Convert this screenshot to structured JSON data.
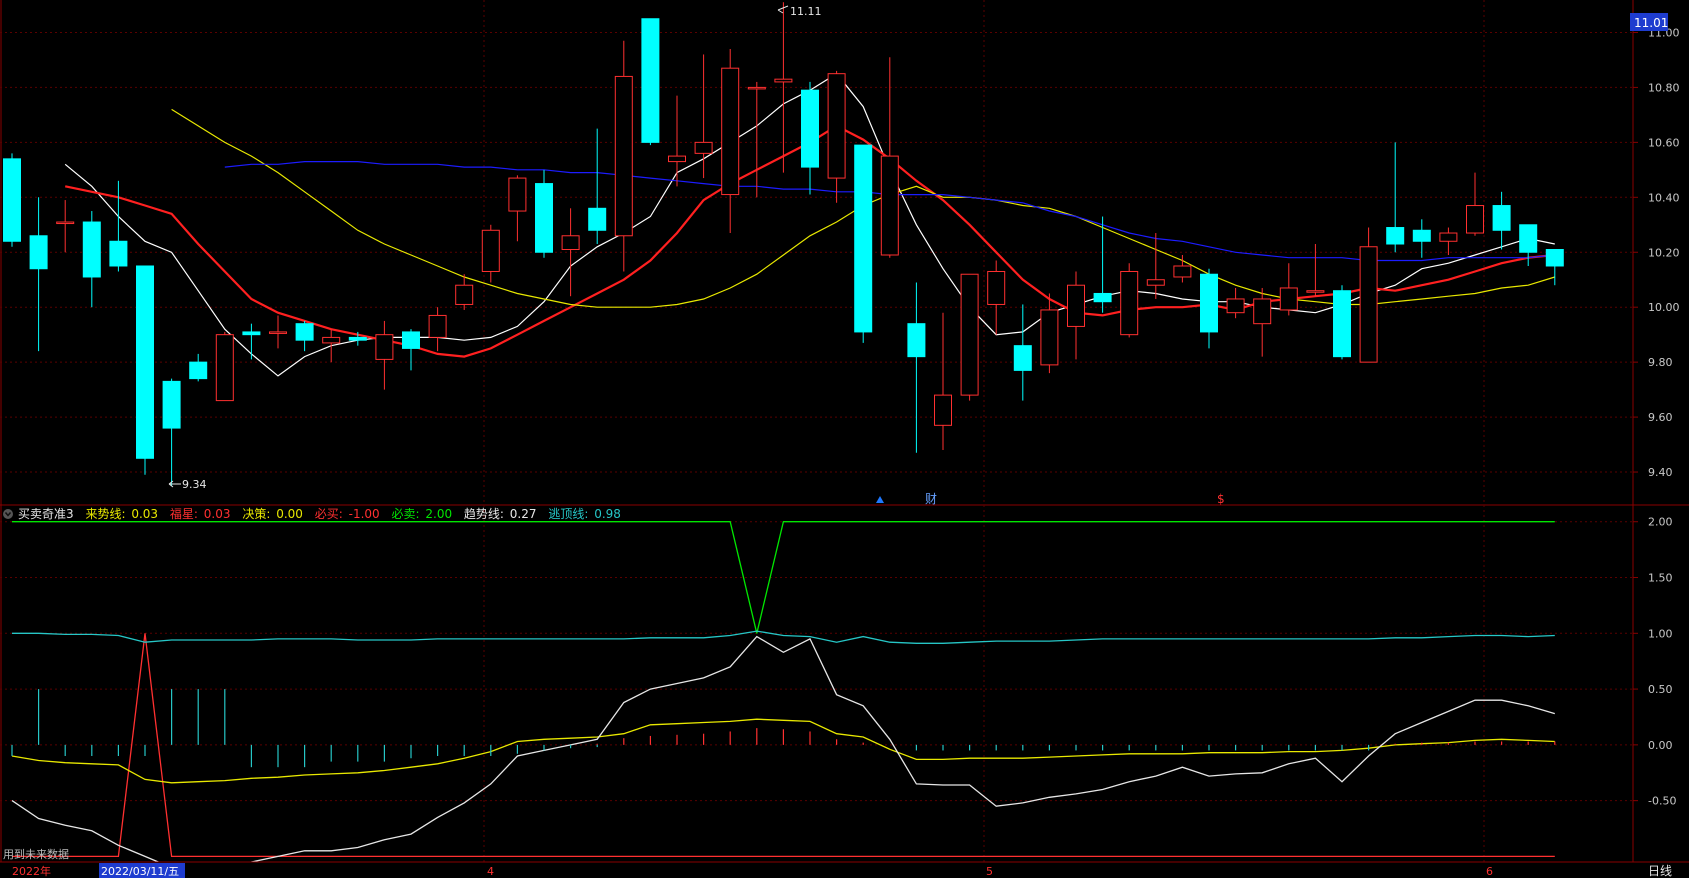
{
  "colors": {
    "up": "#ff3030",
    "down": "#00ffff",
    "grid": "#5a0000",
    "axis": "#8a0000",
    "ma5": "#ffffff",
    "ma10": "#ff2020",
    "ma20": "#e8e800",
    "ma60": "#1c1cff",
    "green": "#00e600",
    "cyan": "#26c6c6",
    "yellow": "#e8e800"
  },
  "price_panel": {
    "last_price_badge": "11.01",
    "high_annotation": "11.11",
    "low_annotation": "9.34",
    "event_marker_1": "财",
    "event_marker_2": "$"
  },
  "indicator_panel": {
    "name": "买卖奇准3",
    "items": [
      {
        "label": "来势线:",
        "value": "0.03",
        "color": "#e8e800"
      },
      {
        "label": "福星:",
        "value": "0.03",
        "color": "#ff3030"
      },
      {
        "label": "决策:",
        "value": "0.00",
        "color": "#e8e800"
      },
      {
        "label": "必买:",
        "value": "-1.00",
        "color": "#ff3030"
      },
      {
        "label": "必卖:",
        "value": "2.00",
        "color": "#00e600"
      },
      {
        "label": "趋势线:",
        "value": "0.27",
        "color": "#e6e6e6"
      },
      {
        "label": "逃顶线:",
        "value": "0.98",
        "color": "#26c6c6"
      }
    ],
    "footer_note": "用到未来数据"
  },
  "bottom_bar": {
    "year_label": "2022年",
    "cursor_date": "2022/03/11/五",
    "month_labels": [
      "4",
      "5",
      "6"
    ],
    "period": "日线"
  },
  "chart_data": [
    {
      "type": "candlestick",
      "title": "",
      "ylim": [
        9.28,
        11.1
      ],
      "yticks": [
        "11.00",
        "10.80",
        "10.60",
        "10.40",
        "10.20",
        "10.00",
        "9.80",
        "9.60",
        "9.40"
      ],
      "candles": [
        [
          10.54,
          10.24,
          10.56,
          10.22
        ],
        [
          10.26,
          10.14,
          10.4,
          9.84
        ],
        [
          10.31,
          10.31,
          10.39,
          10.2
        ],
        [
          10.31,
          10.11,
          10.35,
          10.0
        ],
        [
          10.24,
          10.15,
          10.46,
          10.13
        ],
        [
          10.15,
          9.45,
          10.15,
          9.39
        ],
        [
          9.73,
          9.56,
          9.74,
          9.35
        ],
        [
          9.8,
          9.74,
          9.83,
          9.73
        ],
        [
          9.66,
          9.9,
          9.91,
          9.66
        ],
        [
          9.91,
          9.9,
          9.94,
          9.81
        ],
        [
          9.91,
          9.91,
          9.97,
          9.85
        ],
        [
          9.94,
          9.88,
          9.95,
          9.84
        ],
        [
          9.87,
          9.89,
          9.92,
          9.8
        ],
        [
          9.89,
          9.88,
          9.91,
          9.86
        ],
        [
          9.81,
          9.9,
          9.95,
          9.7
        ],
        [
          9.91,
          9.85,
          9.92,
          9.77
        ],
        [
          9.89,
          9.97,
          10.0,
          9.84
        ],
        [
          10.01,
          10.08,
          10.12,
          9.99
        ],
        [
          10.13,
          10.28,
          10.3,
          10.09
        ],
        [
          10.35,
          10.47,
          10.48,
          10.24
        ],
        [
          10.45,
          10.2,
          10.5,
          10.18
        ],
        [
          10.21,
          10.26,
          10.36,
          10.04
        ],
        [
          10.36,
          10.28,
          10.65,
          10.23
        ],
        [
          10.26,
          10.84,
          10.97,
          10.13
        ],
        [
          11.05,
          10.6,
          11.05,
          10.59
        ],
        [
          10.53,
          10.55,
          10.77,
          10.44
        ],
        [
          10.56,
          10.6,
          10.92,
          10.47
        ],
        [
          10.41,
          10.87,
          10.94,
          10.27
        ],
        [
          10.8,
          10.8,
          10.82,
          10.4
        ],
        [
          10.82,
          10.83,
          11.11,
          10.49
        ],
        [
          10.79,
          10.51,
          10.82,
          10.41
        ],
        [
          10.47,
          10.85,
          10.86,
          10.38
        ],
        [
          10.59,
          9.91,
          10.59,
          9.87
        ],
        [
          10.19,
          10.55,
          10.91,
          10.18
        ],
        [
          9.94,
          9.82,
          10.09,
          9.47
        ],
        [
          9.57,
          9.68,
          9.98,
          9.48
        ],
        [
          9.68,
          10.12,
          10.12,
          9.66
        ],
        [
          10.01,
          10.13,
          10.17,
          9.9
        ],
        [
          9.86,
          9.77,
          10.01,
          9.66
        ],
        [
          9.79,
          9.99,
          10.05,
          9.76
        ],
        [
          9.93,
          10.08,
          10.13,
          9.81
        ],
        [
          10.05,
          10.02,
          10.33,
          9.98
        ],
        [
          9.9,
          10.13,
          10.16,
          9.89
        ],
        [
          10.08,
          10.1,
          10.27,
          10.03
        ],
        [
          10.11,
          10.15,
          10.19,
          10.09
        ],
        [
          10.12,
          9.91,
          10.14,
          9.85
        ],
        [
          9.98,
          10.03,
          10.07,
          9.96
        ],
        [
          9.94,
          10.03,
          10.07,
          9.82
        ],
        [
          9.99,
          10.07,
          10.16,
          9.97
        ],
        [
          10.06,
          10.06,
          10.23,
          10.04
        ],
        [
          10.06,
          9.82,
          10.08,
          9.81
        ],
        [
          9.8,
          10.22,
          10.29,
          9.8
        ],
        [
          10.29,
          10.23,
          10.6,
          10.2
        ],
        [
          10.28,
          10.24,
          10.32,
          10.18
        ],
        [
          10.24,
          10.27,
          10.29,
          10.19
        ],
        [
          10.27,
          10.37,
          10.49,
          10.26
        ],
        [
          10.37,
          10.28,
          10.42,
          10.21
        ],
        [
          10.3,
          10.2,
          10.3,
          10.15
        ],
        [
          10.21,
          10.15,
          10.21,
          10.08
        ]
      ],
      "series": [
        {
          "name": "MA5",
          "color": "#ffffff",
          "values": [
            10.52,
            10.44,
            10.33,
            10.24,
            10.2,
            10.06,
            9.92,
            9.83,
            9.75,
            9.82,
            9.86,
            9.88,
            9.89,
            9.89,
            9.89,
            9.88,
            9.89,
            9.93,
            10.02,
            10.15,
            10.22,
            10.27,
            10.33,
            10.49,
            10.54,
            10.6,
            10.66,
            10.74,
            10.79,
            10.85,
            10.73,
            10.5,
            10.3,
            10.14,
            10.0,
            9.9,
            9.91,
            9.98,
            10.01,
            10.04,
            10.06,
            10.05,
            10.03,
            10.02,
            10.02,
            10.0,
            9.99,
            9.98,
            10.01,
            10.05,
            10.08,
            10.14,
            10.16,
            10.19,
            10.22,
            10.25,
            10.23
          ]
        },
        {
          "name": "MA10",
          "color": "#ff2020",
          "values": [
            10.44,
            10.42,
            10.4,
            10.37,
            10.34,
            10.23,
            10.13,
            10.03,
            9.98,
            9.95,
            9.92,
            9.9,
            9.88,
            9.86,
            9.83,
            9.82,
            9.85,
            9.9,
            9.95,
            10.0,
            10.05,
            10.1,
            10.17,
            10.27,
            10.39,
            10.45,
            10.5,
            10.55,
            10.6,
            10.66,
            10.61,
            10.54,
            10.46,
            10.39,
            10.3,
            10.2,
            10.1,
            10.03,
            9.98,
            9.97,
            9.99,
            10.0,
            10.0,
            10.01,
            9.99,
            10.02,
            10.03,
            10.04,
            10.05,
            10.07,
            10.06,
            10.08,
            10.1,
            10.13,
            10.16,
            10.18,
            10.19
          ]
        },
        {
          "name": "MA20",
          "color": "#e8e800",
          "values": [
            10.72,
            10.66,
            10.6,
            10.55,
            10.49,
            10.42,
            10.35,
            10.28,
            10.23,
            10.19,
            10.15,
            10.11,
            10.08,
            10.05,
            10.03,
            10.01,
            10.0,
            10.0,
            10.0,
            10.01,
            10.03,
            10.07,
            10.12,
            10.19,
            10.26,
            10.31,
            10.37,
            10.41,
            10.44,
            10.4,
            10.4,
            10.39,
            10.37,
            10.36,
            10.33,
            10.29,
            10.25,
            10.21,
            10.17,
            10.12,
            10.08,
            10.05,
            10.03,
            10.02,
            10.01,
            10.01,
            10.02,
            10.03,
            10.04,
            10.05,
            10.07,
            10.08,
            10.11
          ]
        },
        {
          "name": "MA60",
          "color": "#1c1cff",
          "values": [
            10.51,
            10.52,
            10.52,
            10.53,
            10.53,
            10.53,
            10.52,
            10.52,
            10.52,
            10.51,
            10.51,
            10.5,
            10.5,
            10.49,
            10.49,
            10.48,
            10.47,
            10.46,
            10.45,
            10.44,
            10.44,
            10.43,
            10.43,
            10.42,
            10.42,
            10.41,
            10.41,
            10.41,
            10.4,
            10.39,
            10.38,
            10.35,
            10.33,
            10.3,
            10.27,
            10.25,
            10.24,
            10.22,
            10.2,
            10.19,
            10.18,
            10.18,
            10.18,
            10.17,
            10.17,
            10.17,
            10.18,
            10.18,
            10.18,
            10.18,
            10.19
          ]
        }
      ]
    },
    {
      "type": "line",
      "title": "买卖奇准3",
      "ylim": [
        -1.05,
        2.15
      ],
      "yticks": [
        "2.00",
        "1.50",
        "1.00",
        "0.50",
        "0.00",
        "-0.50"
      ],
      "series": [
        {
          "name": "必卖",
          "color": "#00e600",
          "values": [
            2,
            2,
            2,
            2,
            2,
            2,
            2,
            2,
            2,
            2,
            2,
            2,
            2,
            2,
            2,
            2,
            2,
            2,
            2,
            2,
            2,
            2,
            2,
            2,
            2,
            2,
            2,
            2,
            1.0,
            2,
            2,
            2,
            2,
            2,
            2,
            2,
            2,
            2,
            2,
            2,
            2,
            2,
            2,
            2,
            2,
            2,
            2,
            2,
            2,
            2,
            2,
            2,
            2,
            2,
            2,
            2,
            2,
            2,
            2
          ]
        },
        {
          "name": "必买",
          "color": "#ff3030",
          "values": [
            -1,
            -1,
            -1,
            -1,
            -1,
            1,
            -1,
            -1,
            -1,
            -1,
            -1,
            -1,
            -1,
            -1,
            -1,
            -1,
            -1,
            -1,
            -1,
            -1,
            -1,
            -1,
            -1,
            -1,
            -1,
            -1,
            -1,
            -1,
            -1,
            -1,
            -1,
            -1,
            -1,
            -1,
            -1,
            -1,
            -1,
            -1,
            -1,
            -1,
            -1,
            -1,
            -1,
            -1,
            -1,
            -1,
            -1,
            -1,
            -1,
            -1,
            -1,
            -1,
            -1,
            -1,
            -1,
            -1,
            -1,
            -1,
            -1
          ]
        },
        {
          "name": "逃顶线",
          "color": "#26c6c6",
          "values": [
            1.0,
            1.0,
            0.99,
            0.99,
            0.98,
            0.92,
            0.94,
            0.94,
            0.94,
            0.94,
            0.95,
            0.95,
            0.95,
            0.94,
            0.94,
            0.94,
            0.95,
            0.95,
            0.95,
            0.95,
            0.95,
            0.95,
            0.95,
            0.95,
            0.96,
            0.96,
            0.96,
            0.98,
            1.02,
            0.98,
            0.97,
            0.92,
            0.97,
            0.92,
            0.91,
            0.91,
            0.92,
            0.93,
            0.93,
            0.93,
            0.94,
            0.95,
            0.95,
            0.95,
            0.95,
            0.95,
            0.95,
            0.95,
            0.95,
            0.95,
            0.95,
            0.95,
            0.96,
            0.96,
            0.97,
            0.98,
            0.98,
            0.97,
            0.98
          ]
        },
        {
          "name": "来势线",
          "color": "#e8e800",
          "values": [
            -0.1,
            -0.14,
            -0.16,
            -0.17,
            -0.18,
            -0.31,
            -0.34,
            -0.33,
            -0.32,
            -0.3,
            -0.29,
            -0.27,
            -0.26,
            -0.25,
            -0.23,
            -0.2,
            -0.17,
            -0.12,
            -0.06,
            0.03,
            0.05,
            0.06,
            0.07,
            0.1,
            0.18,
            0.19,
            0.2,
            0.21,
            0.23,
            0.22,
            0.21,
            0.1,
            0.07,
            -0.04,
            -0.13,
            -0.13,
            -0.12,
            -0.12,
            -0.12,
            -0.11,
            -0.1,
            -0.09,
            -0.08,
            -0.08,
            -0.08,
            -0.07,
            -0.07,
            -0.07,
            -0.06,
            -0.06,
            -0.05,
            -0.03,
            0.0,
            0.01,
            0.02,
            0.04,
            0.05,
            0.04,
            0.03
          ]
        },
        {
          "name": "趋势线",
          "color": "#e6e6e6",
          "values": [
            -0.5,
            -0.66,
            -0.72,
            -0.77,
            -0.9,
            -1.0,
            -1.1,
            -1.15,
            -1.1,
            -1.05,
            -1.0,
            -0.95,
            -0.95,
            -0.92,
            -0.85,
            -0.8,
            -0.65,
            -0.52,
            -0.35,
            -0.1,
            -0.05,
            0.0,
            0.05,
            0.38,
            0.5,
            0.55,
            0.6,
            0.7,
            0.97,
            0.83,
            0.95,
            0.45,
            0.35,
            0.05,
            -0.35,
            -0.36,
            -0.36,
            -0.55,
            -0.52,
            -0.47,
            -0.44,
            -0.4,
            -0.33,
            -0.28,
            -0.2,
            -0.28,
            -0.26,
            -0.25,
            -0.17,
            -0.12,
            -0.33,
            -0.1,
            0.1,
            0.2,
            0.3,
            0.4,
            0.4,
            0.35,
            0.28
          ]
        },
        {
          "name": "福星",
          "color": "#ff3030",
          "values": [
            0,
            0,
            0,
            0,
            0,
            0,
            0,
            0,
            0,
            0,
            0,
            0,
            0,
            0,
            0,
            0,
            0,
            0,
            0,
            0,
            0,
            0,
            0.01,
            0.06,
            0.08,
            0.09,
            0.1,
            0.12,
            0.15,
            0.14,
            0.12,
            0.05,
            0.02,
            0,
            0,
            0,
            0,
            0,
            0,
            0,
            0,
            0,
            0,
            0,
            0,
            0,
            0,
            0,
            0,
            0,
            0,
            0,
            0.01,
            0.02,
            0.02,
            0.03,
            0.03,
            0.03,
            0.03
          ]
        },
        {
          "name": "决策",
          "color": "#26c6c6",
          "values": [
            -0.1,
            0.5,
            -0.1,
            -0.1,
            -0.1,
            -0.1,
            0.5,
            0.5,
            0.5,
            -0.2,
            -0.2,
            -0.2,
            -0.15,
            -0.15,
            -0.15,
            -0.12,
            -0.1,
            -0.1,
            -0.1,
            -0.08,
            -0.05,
            -0.03,
            -0.02,
            0,
            0,
            0,
            0,
            0,
            0,
            0,
            0,
            0,
            0,
            0,
            -0.05,
            -0.05,
            -0.05,
            -0.05,
            -0.05,
            -0.05,
            -0.05,
            -0.05,
            -0.05,
            -0.05,
            -0.05,
            -0.05,
            -0.05,
            -0.05,
            -0.05,
            -0.05,
            -0.05,
            -0.05,
            0,
            0,
            0,
            0,
            0,
            0,
            0
          ]
        }
      ]
    }
  ]
}
